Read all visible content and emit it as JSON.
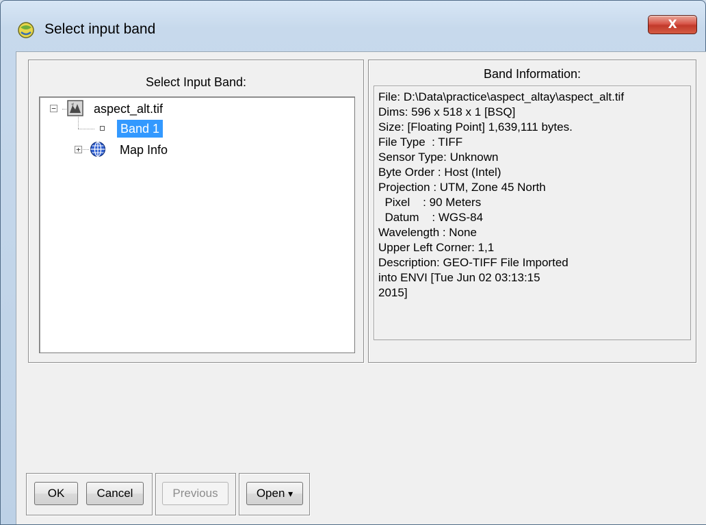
{
  "window": {
    "title": "Select input band",
    "close_label": "X"
  },
  "tree_panel": {
    "title": "Select Input Band:",
    "root": {
      "label": "aspect_alt.tif",
      "expander": "−",
      "icon": "image-file-icon"
    },
    "band": {
      "label": "Band 1",
      "selected": true
    },
    "map_info": {
      "label": "Map Info",
      "expander": "+",
      "icon": "globe-icon"
    }
  },
  "info_panel": {
    "title": "Band Information:",
    "lines": [
      "File: D:\\Data\\practice\\aspect_altay\\aspect_alt.tif",
      "Dims: 596 x 518 x 1 [BSQ]",
      "Size: [Floating Point] 1,639,111 bytes.",
      "File Type  : TIFF",
      "Sensor Type: Unknown",
      "Byte Order : Host (Intel)",
      "Projection : UTM, Zone 45 North",
      "  Pixel    : 90 Meters",
      "  Datum    : WGS-84",
      "Wavelength : None",
      "Upper Left Corner: 1,1",
      "Description: GEO-TIFF File Imported",
      "into ENVI [Tue Jun 02 03:13:15",
      "2015]"
    ]
  },
  "buttons": {
    "ok": "OK",
    "cancel": "Cancel",
    "previous": "Previous",
    "open": "Open",
    "open_arrow": "▾"
  }
}
